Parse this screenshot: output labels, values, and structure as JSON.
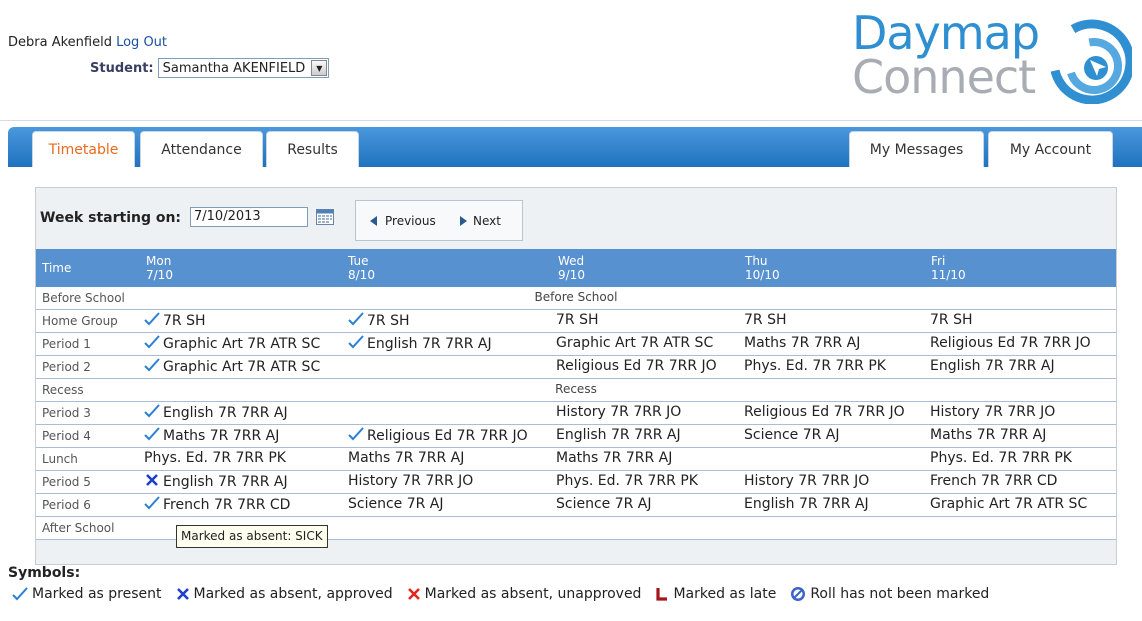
{
  "header": {
    "user_name": "Debra Akenfield",
    "logout_label": "Log Out",
    "student_label": "Student:",
    "student_value": "Samantha AKENFIELD"
  },
  "logo": {
    "line1": "Daymap",
    "line2": "Connect"
  },
  "tabs": {
    "timetable": "Timetable",
    "attendance": "Attendance",
    "results": "Results",
    "messages": "My Messages",
    "account": "My Account"
  },
  "week": {
    "label": "Week starting on:",
    "date": "7/10/2013",
    "prev_label": "Previous",
    "next_label": "Next"
  },
  "table": {
    "time_header": "Time",
    "days": [
      {
        "day": "Mon",
        "date": "7/10"
      },
      {
        "day": "Tue",
        "date": "8/10"
      },
      {
        "day": "Wed",
        "date": "9/10"
      },
      {
        "day": "Thu",
        "date": "10/10"
      },
      {
        "day": "Fri",
        "date": "11/10"
      }
    ],
    "rows": [
      {
        "label": "Before School",
        "span": "Before School"
      },
      {
        "label": "Home Group",
        "cells": [
          {
            "text": "7R SH",
            "mark": "present"
          },
          {
            "text": "7R SH",
            "mark": "present"
          },
          {
            "text": "7R SH"
          },
          {
            "text": "7R SH"
          },
          {
            "text": "7R SH"
          }
        ]
      },
      {
        "label": "Period 1",
        "cells": [
          {
            "text": "Graphic Art 7R ATR SC",
            "mark": "present"
          },
          {
            "text": "English 7R 7RR AJ",
            "mark": "present"
          },
          {
            "text": "Graphic Art 7R ATR SC"
          },
          {
            "text": "Maths 7R 7RR AJ"
          },
          {
            "text": "Religious Ed 7R 7RR JO"
          }
        ]
      },
      {
        "label": "Period 2",
        "cells": [
          {
            "text": "Graphic Art 7R ATR SC",
            "mark": "present"
          },
          {
            "text": ""
          },
          {
            "text": "Religious Ed 7R 7RR JO"
          },
          {
            "text": "Phys. Ed. 7R 7RR PK"
          },
          {
            "text": "English 7R 7RR AJ"
          }
        ]
      },
      {
        "label": "Recess",
        "span": "Recess"
      },
      {
        "label": "Period 3",
        "cells": [
          {
            "text": "English 7R 7RR AJ",
            "mark": "present"
          },
          {
            "text": ""
          },
          {
            "text": "History 7R 7RR JO"
          },
          {
            "text": "Religious Ed 7R 7RR JO"
          },
          {
            "text": "History 7R 7RR JO"
          }
        ]
      },
      {
        "label": "Period 4",
        "cells": [
          {
            "text": "Maths 7R 7RR AJ",
            "mark": "present"
          },
          {
            "text": "Religious Ed 7R 7RR JO",
            "mark": "present"
          },
          {
            "text": "English 7R 7RR AJ"
          },
          {
            "text": "Science 7R AJ"
          },
          {
            "text": "Maths 7R 7RR AJ"
          }
        ]
      },
      {
        "label": "Lunch",
        "cells": [
          {
            "text": "Phys. Ed. 7R 7RR PK"
          },
          {
            "text": "Maths 7R 7RR AJ"
          },
          {
            "text": "Maths 7R 7RR AJ"
          },
          {
            "text": ""
          },
          {
            "text": "Phys. Ed. 7R 7RR PK"
          }
        ]
      },
      {
        "label": "Period 5",
        "cells": [
          {
            "text": "English 7R 7RR AJ",
            "mark": "absent-approved"
          },
          {
            "text": "History 7R 7RR JO"
          },
          {
            "text": "Phys. Ed. 7R 7RR PK"
          },
          {
            "text": "History 7R 7RR JO"
          },
          {
            "text": "French 7R 7RR CD"
          }
        ]
      },
      {
        "label": "Period 6",
        "cells": [
          {
            "text": "French 7R 7RR CD",
            "mark": "present"
          },
          {
            "text": "Science 7R AJ"
          },
          {
            "text": "Science 7R AJ"
          },
          {
            "text": "English 7R 7RR AJ"
          },
          {
            "text": "Graphic Art 7R ATR SC"
          }
        ]
      },
      {
        "label": "After School",
        "span": ""
      }
    ]
  },
  "tooltip": "Marked as absent: SICK",
  "symbols": {
    "title": "Symbols:",
    "items": [
      {
        "icon": "check-icon",
        "label": "Marked as present"
      },
      {
        "icon": "blue-x-icon",
        "label": "Marked as absent, approved"
      },
      {
        "icon": "red-x-icon",
        "label": "Marked as absent, unapproved"
      },
      {
        "icon": "late-l-icon",
        "label": "Marked as late"
      },
      {
        "icon": "not-marked-icon",
        "label": "Roll has not been marked"
      }
    ]
  },
  "colors": {
    "accent_blue": "#2f8fd1",
    "nav_blue": "#1f72bf",
    "header_blue": "#5891cf",
    "active_tab": "#ea6a1e",
    "present": "#2b7fd4",
    "absent_approved": "#1d3fd1",
    "absent_unapproved": "#e0281c",
    "late": "#a4161a"
  }
}
